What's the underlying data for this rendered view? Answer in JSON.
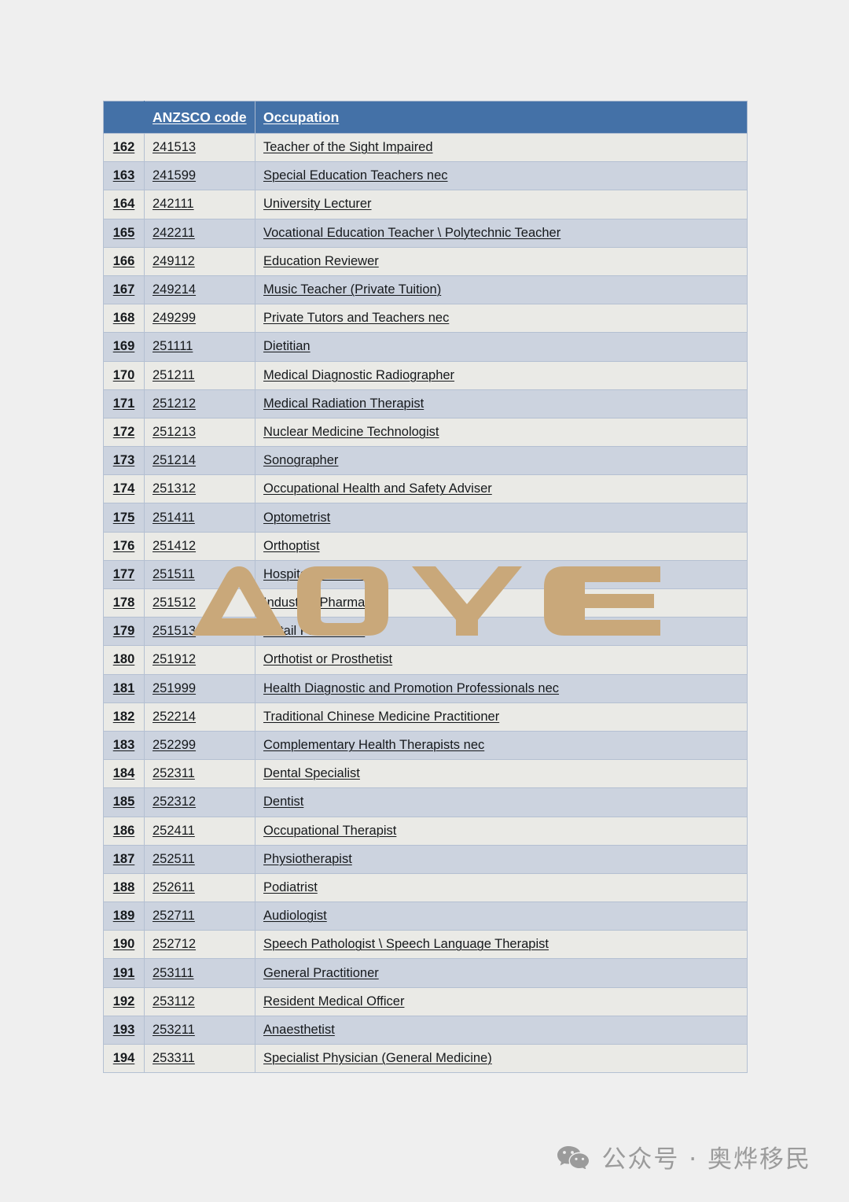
{
  "document": {
    "background_color": "#efefef",
    "header_fill": "#4471a7",
    "row_light": "#eaeae6",
    "row_dark": "#ccd3df",
    "border_color": "#b4c0d2"
  },
  "table": {
    "columns": [
      "",
      "ANZSCO code",
      "Occupation"
    ],
    "header": {
      "index_label": "",
      "code_label": "ANZSCO code",
      "occupation_label": "Occupation"
    },
    "rows": [
      {
        "index": "162",
        "code": "241513",
        "occupation": "Teacher of the Sight Impaired"
      },
      {
        "index": "163",
        "code": "241599",
        "occupation": "Special Education Teachers nec"
      },
      {
        "index": "164",
        "code": "242111",
        "occupation": "University Lecturer"
      },
      {
        "index": "165",
        "code": "242211",
        "occupation": "Vocational Education Teacher \\ Polytechnic Teacher"
      },
      {
        "index": "166",
        "code": "249112",
        "occupation": "Education Reviewer"
      },
      {
        "index": "167",
        "code": "249214",
        "occupation": "Music Teacher (Private Tuition)"
      },
      {
        "index": "168",
        "code": "249299",
        "occupation": "Private Tutors and Teachers nec"
      },
      {
        "index": "169",
        "code": "251111",
        "occupation": "Dietitian"
      },
      {
        "index": "170",
        "code": "251211",
        "occupation": "Medical Diagnostic Radiographer"
      },
      {
        "index": "171",
        "code": "251212",
        "occupation": "Medical Radiation Therapist"
      },
      {
        "index": "172",
        "code": "251213",
        "occupation": "Nuclear Medicine Technologist"
      },
      {
        "index": "173",
        "code": "251214",
        "occupation": "Sonographer"
      },
      {
        "index": "174",
        "code": "251312",
        "occupation": "Occupational Health and Safety Adviser"
      },
      {
        "index": "175",
        "code": "251411",
        "occupation": "Optometrist"
      },
      {
        "index": "176",
        "code": "251412",
        "occupation": "Orthoptist"
      },
      {
        "index": "177",
        "code": "251511",
        "occupation": "Hospital Pharmacist"
      },
      {
        "index": "178",
        "code": "251512",
        "occupation": "Industrial Pharmacist"
      },
      {
        "index": "179",
        "code": "251513",
        "occupation": "Retail Pharmacist"
      },
      {
        "index": "180",
        "code": "251912",
        "occupation": "Orthotist or Prosthetist"
      },
      {
        "index": "181",
        "code": "251999",
        "occupation": "Health Diagnostic and Promotion Professionals nec"
      },
      {
        "index": "182",
        "code": "252214",
        "occupation": "Traditional Chinese Medicine Practitioner"
      },
      {
        "index": "183",
        "code": "252299",
        "occupation": "Complementary Health Therapists nec"
      },
      {
        "index": "184",
        "code": "252311",
        "occupation": "Dental Specialist"
      },
      {
        "index": "185",
        "code": "252312",
        "occupation": "Dentist"
      },
      {
        "index": "186",
        "code": "252411",
        "occupation": "Occupational Therapist"
      },
      {
        "index": "187",
        "code": "252511",
        "occupation": "Physiotherapist"
      },
      {
        "index": "188",
        "code": "252611",
        "occupation": "Podiatrist"
      },
      {
        "index": "189",
        "code": "252711",
        "occupation": "Audiologist"
      },
      {
        "index": "190",
        "code": "252712",
        "occupation": "Speech Pathologist \\ Speech Language Therapist"
      },
      {
        "index": "191",
        "code": "253111",
        "occupation": "General Practitioner"
      },
      {
        "index": "192",
        "code": "253112",
        "occupation": "Resident Medical Officer"
      },
      {
        "index": "193",
        "code": "253211",
        "occupation": "Anaesthetist"
      },
      {
        "index": "194",
        "code": "253311",
        "occupation": "Specialist Physician (General Medicine)"
      }
    ]
  },
  "watermark": {
    "text": "AOYE",
    "color": "#c9a87a"
  },
  "footer": {
    "icon": "wechat-icon",
    "text": "公众号 · 奥烨移民",
    "color": "#9b9b9b"
  }
}
